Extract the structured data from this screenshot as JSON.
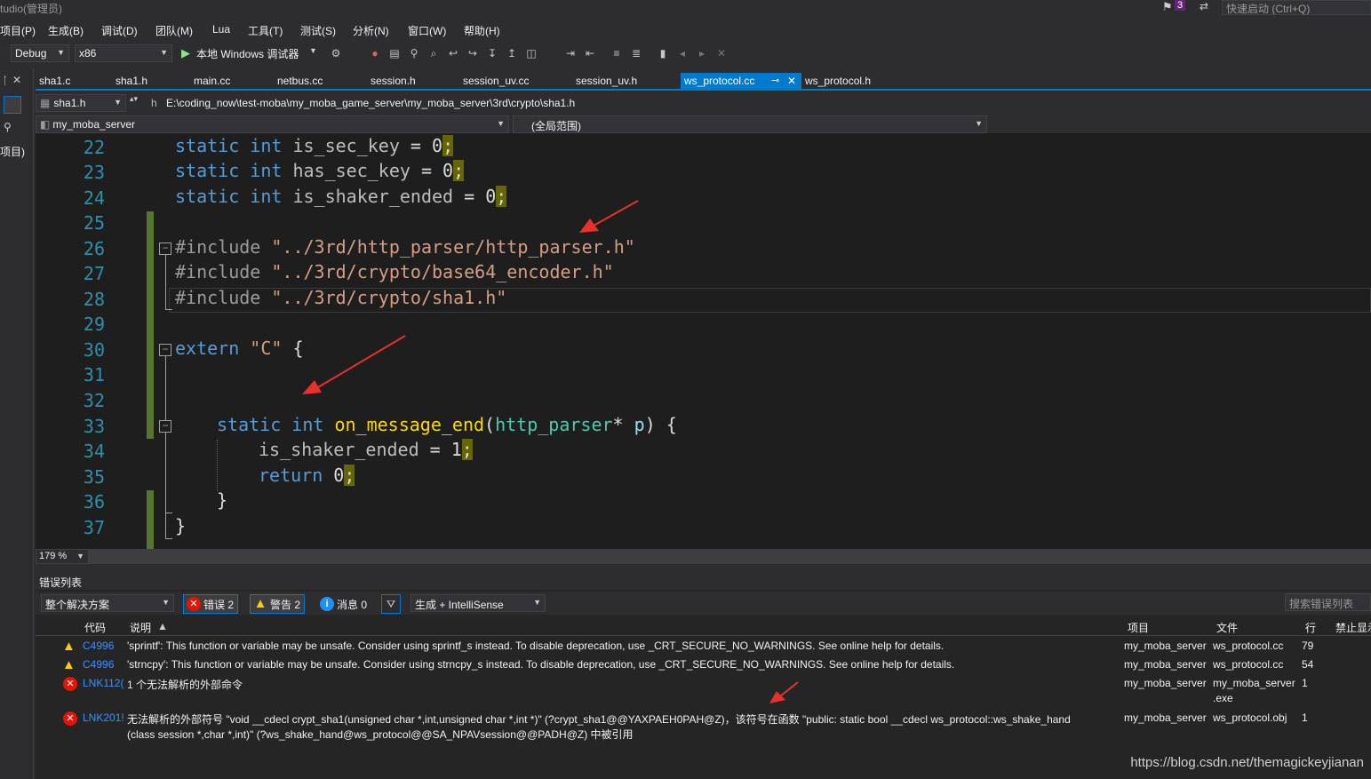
{
  "title": "tudio(管理员)",
  "notif_count": "3",
  "quick_launch": "快速启动 (Ctrl+Q)",
  "menu": [
    "项目(P)",
    "生成(B)",
    "调试(D)",
    "团队(M)",
    "Lua",
    "工具(T)",
    "测试(S)",
    "分析(N)",
    "窗口(W)",
    "帮助(H)"
  ],
  "toolbar": {
    "config": "Debug",
    "platform": "x86",
    "run_label": "本地 Windows 调试器"
  },
  "tabs": [
    "sha1.c",
    "sha1.h",
    "main.cc",
    "netbus.cc",
    "session.h",
    "session_uv.cc",
    "session_uv.h",
    "ws_protocol.cc",
    "ws_protocol.h"
  ],
  "active_tab": "ws_protocol.cc",
  "nav": {
    "file": "sha1.h",
    "path": "E:\\coding_now\\test-moba\\my_moba_game_server\\my_moba_server\\3rd\\crypto\\sha1.h",
    "project": "my_moba_server",
    "scope": "(全局范围)"
  },
  "left_panel_label": "项目)",
  "editor": {
    "lines": [
      {
        "n": "22",
        "text": "static int is_sec_key = 0;"
      },
      {
        "n": "23",
        "text": "static int has_sec_key = 0;"
      },
      {
        "n": "24",
        "text": "static int is_shaker_ended = 0;"
      },
      {
        "n": "25",
        "text": ""
      },
      {
        "n": "26",
        "text": "#include \"../3rd/http_parser/http_parser.h\""
      },
      {
        "n": "27",
        "text": "#include \"../3rd/crypto/base64_encoder.h\""
      },
      {
        "n": "28",
        "text": "#include \"../3rd/crypto/sha1.h\""
      },
      {
        "n": "29",
        "text": ""
      },
      {
        "n": "30",
        "text": "extern \"C\" {"
      },
      {
        "n": "31",
        "text": ""
      },
      {
        "n": "32",
        "text": ""
      },
      {
        "n": "33",
        "text": "static int on_message_end(http_parser* p) {"
      },
      {
        "n": "34",
        "text": "is_shaker_ended = 1;"
      },
      {
        "n": "35",
        "text": "return 0;"
      },
      {
        "n": "36",
        "text": "}"
      },
      {
        "n": "37",
        "text": "}"
      }
    ],
    "zoom": "179 %"
  },
  "errors": {
    "panel_title": "错误列表",
    "scope": "整个解决方案",
    "errors_btn": "错误 2",
    "warnings_btn": "警告 2",
    "messages_btn": "消息 0",
    "source": "生成 + IntelliSense",
    "search_placeholder": "搜索错误列表",
    "columns": {
      "code": "代码",
      "desc": "说明",
      "project": "项目",
      "file": "文件",
      "line": "行",
      "suppress": "禁止显示"
    },
    "rows": [
      {
        "type": "warning",
        "code": "C4996",
        "desc": "'sprintf': This function or variable may be unsafe. Consider using sprintf_s instead. To disable deprecation, use _CRT_SECURE_NO_WARNINGS. See online help for details.",
        "desc2": "",
        "project": "my_moba_server",
        "file": "ws_protocol.cc",
        "file2": "",
        "line": "79"
      },
      {
        "type": "warning",
        "code": "C4996",
        "desc": "'strncpy': This function or variable may be unsafe. Consider using strncpy_s instead. To disable deprecation, use _CRT_SECURE_NO_WARNINGS. See online help for details.",
        "desc2": "",
        "project": "my_moba_server",
        "file": "ws_protocol.cc",
        "file2": "",
        "line": "54"
      },
      {
        "type": "error",
        "code": "LNK112(",
        "desc": "1 个无法解析的外部命令",
        "desc2": "",
        "project": "my_moba_server",
        "file": "my_moba_server",
        "file2": ".exe",
        "line": "1"
      },
      {
        "type": "error",
        "code": "LNK201!",
        "desc": "无法解析的外部符号 \"void __cdecl crypt_sha1(unsigned char *,int,unsigned char *,int *)\" (?crypt_sha1@@YAXPAEH0PAH@Z)，该符号在函数 \"public: static bool __cdecl ws_protocol::ws_shake_hand",
        "desc2": "(class session *,char *,int)\" (?ws_shake_hand@ws_protocol@@SA_NPAVsession@@PADH@Z) 中被引用",
        "project": "my_moba_server",
        "file": "ws_protocol.obj",
        "file2": "",
        "line": "1"
      }
    ]
  },
  "watermark": "https://blog.csdn.net/themagickeyjianan",
  "colors": {
    "accent": "#007acc",
    "arrow": "#e8312a",
    "change_bar": "#577430"
  }
}
